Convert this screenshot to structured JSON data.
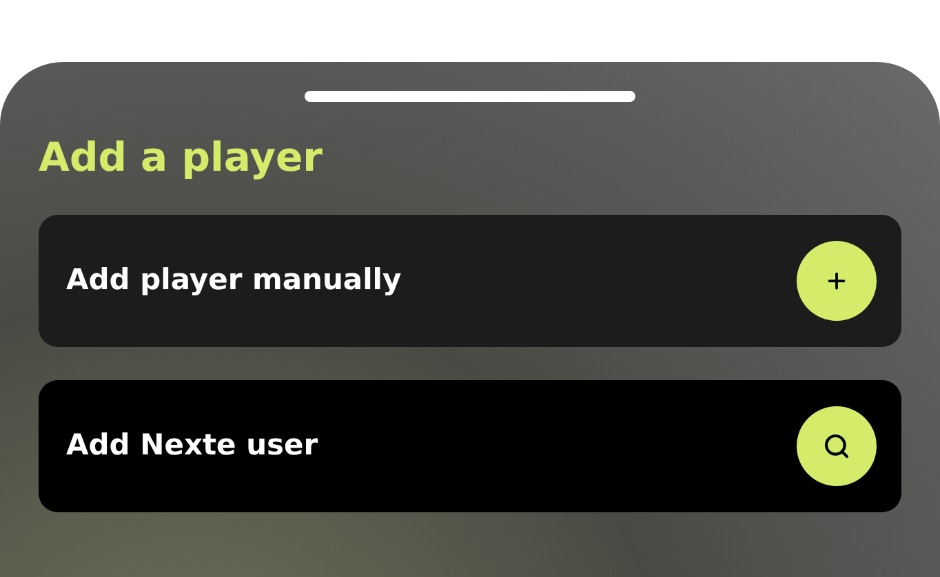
{
  "sheet": {
    "title": "Add a player",
    "options": [
      {
        "label": "Add player manually",
        "kind": "plus",
        "selected": false
      },
      {
        "label": "Add Nexte user",
        "kind": "search",
        "selected": true
      }
    ]
  }
}
